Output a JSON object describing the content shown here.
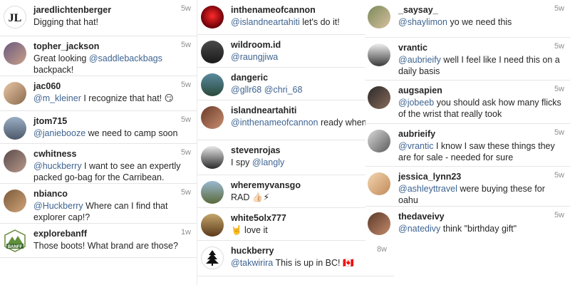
{
  "columns": [
    {
      "comments": [
        {
          "username": "jaredlichtenberger",
          "time": "5w",
          "text": "Digging that hat!",
          "mention": "",
          "icon": "jl-logo"
        },
        {
          "username": "topher_jackson",
          "time": "5w",
          "text": "Great looking ",
          "mention": "@saddlebackbags",
          "text_after": " backpack!",
          "icon": "user-photo"
        },
        {
          "username": "jac060",
          "time": "5w",
          "mention": "@m_kleiner",
          "text": " I recognize that hat! 😏",
          "icon": "user-photo"
        },
        {
          "username": "jtom715",
          "time": "5w",
          "mention": "@janiebooze",
          "text": " we need to camp soon",
          "icon": "user-photo"
        },
        {
          "username": "cwhitness",
          "time": "5w",
          "mention": "@huckberry",
          "text": " I want to see an expertly packed go-bag for the Carribean.",
          "icon": "user-photo"
        },
        {
          "username": "nbianco",
          "time": "5w",
          "mention": "@Huckberry",
          "text": " Where can I find that explorer cap!?",
          "icon": "user-photo"
        },
        {
          "username": "explorebanff",
          "time": "1w",
          "text": "Those boots! What brand are those?",
          "mention": "",
          "icon": "banff-badge",
          "badge_text": "BANFF"
        }
      ]
    },
    {
      "comments": [
        {
          "username": "inthenameofcannon",
          "time": "",
          "mention": "@islandneartahiti",
          "text": " let's do it!",
          "icon": "user-photo"
        },
        {
          "username": "wildroom.id",
          "time": "",
          "mention": "@raungjiwa",
          "text": "",
          "icon": "user-photo"
        },
        {
          "username": "dangeric",
          "time": "",
          "mention": "@gllr68 @chri_68",
          "text": "",
          "icon": "user-photo"
        },
        {
          "username": "islandneartahiti",
          "time": "",
          "mention": "@inthenameofcannon",
          "text": " ready when are",
          "icon": "user-photo"
        },
        {
          "username": "stevenrojas",
          "time": "",
          "text": "I spy ",
          "mention": "@langly",
          "icon": "user-photo"
        },
        {
          "username": "wheremyvansgo",
          "time": "",
          "text": "RAD 👍🏻⚡",
          "mention": "",
          "icon": "user-photo"
        },
        {
          "username": "white5olx777",
          "time": "",
          "text": "🤘 love it",
          "mention": "",
          "icon": "user-photo"
        },
        {
          "username": "huckberry",
          "time": "8w",
          "mention": "@takwirira",
          "text": " This is up in BC! 🇨🇦",
          "icon": "tree-logo"
        }
      ]
    },
    {
      "comments": [
        {
          "username": "_saysay_",
          "time": "5w",
          "mention": "@shaylimon",
          "text": " yo we need this",
          "icon": "user-photo"
        },
        {
          "username": "vrantic",
          "time": "5w",
          "mention": "@aubrieify",
          "text": " well I feel like I need this on a daily basis",
          "icon": "user-photo"
        },
        {
          "username": "augsapien",
          "time": "5w",
          "mention": "@jobeeb",
          "text": " you should ask how many flicks of the wrist that really took",
          "icon": "user-photo"
        },
        {
          "username": "aubrieify",
          "time": "5w",
          "mention": "@vrantic",
          "text": " I know I saw these things they are for sale - needed for sure",
          "icon": "user-photo"
        },
        {
          "username": "jessica_lynn23",
          "time": "5w",
          "mention": "@ashleyttravel",
          "text": "  were buying these for oahu",
          "icon": "user-photo"
        },
        {
          "username": "thedaveivy",
          "time": "5w",
          "mention": "@natedivy",
          "text": " think \"birthday gift\"",
          "icon": "user-photo"
        }
      ]
    }
  ],
  "colors": {
    "mention": "#3e6491",
    "username": "#262626",
    "time": "#8e8e8e",
    "divider": "#e6e6e6"
  }
}
